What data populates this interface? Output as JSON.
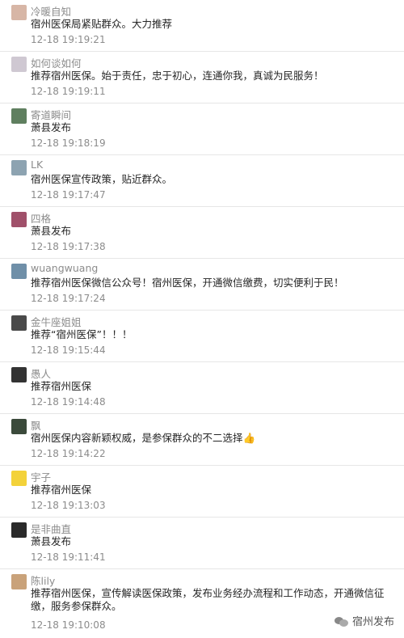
{
  "comments": [
    {
      "name": "冷暖自知",
      "content": "宿州医保局紧贴群众。大力推荐",
      "time": "12-18 19:19:21",
      "avatar_color": "#d7b6a6"
    },
    {
      "name": "如何谈如何",
      "content": "推荐宿州医保。始于责任，忠于初心，连通你我，真诚为民服务！",
      "time": "12-18 19:19:11",
      "avatar_color": "#cfc8d2"
    },
    {
      "name": "寄道瞬间",
      "content": "萧县发布",
      "time": "12-18 19:18:19",
      "avatar_color": "#5f7f5f"
    },
    {
      "name": "LK",
      "content": "宿州医保宣传政策，贴近群众。",
      "time": "12-18 19:17:47",
      "avatar_color": "#8da3b1"
    },
    {
      "name": "四格",
      "content": "萧县发布",
      "time": "12-18 19:17:38",
      "avatar_color": "#a0506a"
    },
    {
      "name": "wuangwuang",
      "content": "推荐宿州医保微信公众号！宿州医保，开通微信缴费，切实便利于民！",
      "time": "12-18 19:17:24",
      "avatar_color": "#6f8fa8"
    },
    {
      "name": "金牛座姐姐",
      "content": "推荐“宿州医保”！！！",
      "time": "12-18 19:15:44",
      "avatar_color": "#4a4a4a"
    },
    {
      "name": "愚人",
      "content": "推荐宿州医保",
      "time": "12-18 19:14:48",
      "avatar_color": "#333333"
    },
    {
      "name": "飘",
      "content": "宿州医保内容新颖权威，是参保群众的不二选择👍",
      "time": "12-18 19:14:22",
      "avatar_color": "#3b4a3b"
    },
    {
      "name": "宇子",
      "content": "推荐宿州医保",
      "time": "12-18 19:13:03",
      "avatar_color": "#f3d23a"
    },
    {
      "name": "是非曲直",
      "content": "萧县发布",
      "time": "12-18 19:11:41",
      "avatar_color": "#2a2a2a"
    },
    {
      "name": "陈lily",
      "content": "推荐宿州医保，宣传解读医保政策，发布业务经办流程和工作动态，开通微信征缴，服务参保群众。",
      "time": "12-18 19:10:08",
      "avatar_color": "#c9a27a"
    }
  ],
  "watermark": {
    "text": "宿州发布",
    "icon": "wechat-icon"
  }
}
